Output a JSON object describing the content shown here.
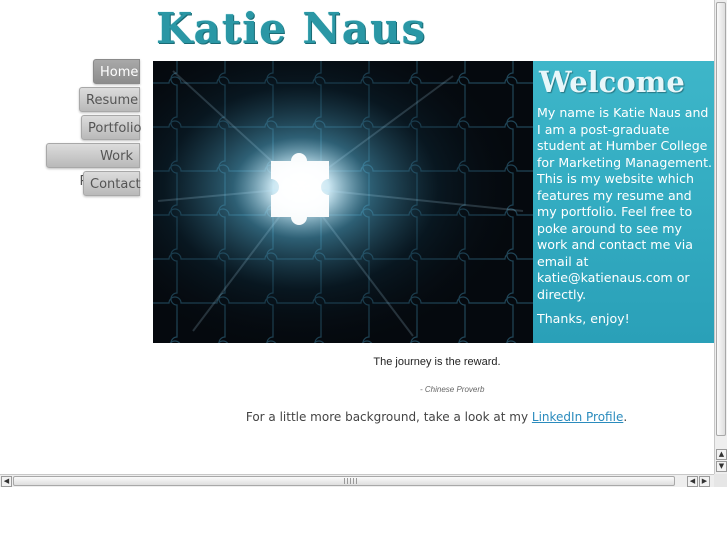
{
  "logo": {
    "text": "Katie Naus"
  },
  "nav": {
    "items": [
      {
        "label": "Home",
        "active": true
      },
      {
        "label": "Resume",
        "active": false
      },
      {
        "label": "Portfolio",
        "active": false
      },
      {
        "label": "Work Portfolio",
        "active": false
      },
      {
        "label": "Contact",
        "active": false
      }
    ]
  },
  "welcome": {
    "title": "Welcome",
    "text": "My name is Katie Naus and I am a post-graduate student at Humber College for Marketing Management. This is my website which features my resume and my portfolio. Feel free to poke around to see my work and contact me via email at ",
    "email": "katie@katienaus.com",
    "text_after": " or directly.",
    "thanks": "Thanks, enjoy!"
  },
  "quote": {
    "text": "The journey is the reward.",
    "attribution": "- Chinese Proverb"
  },
  "background": {
    "prefix": "For a little more background, take a look at my ",
    "link_label": "LinkedIn Profile",
    "suffix": "."
  },
  "colors": {
    "accent": "#35aec3",
    "logo": "#2a97a5",
    "link": "#2a8bbd",
    "nav_active": "#999999"
  },
  "icons": {
    "hero_image": "glowing-puzzle-image",
    "scroll_up": "arrow-up-icon",
    "scroll_down": "arrow-down-icon",
    "scroll_left": "arrow-left-icon",
    "scroll_right": "arrow-right-icon"
  }
}
